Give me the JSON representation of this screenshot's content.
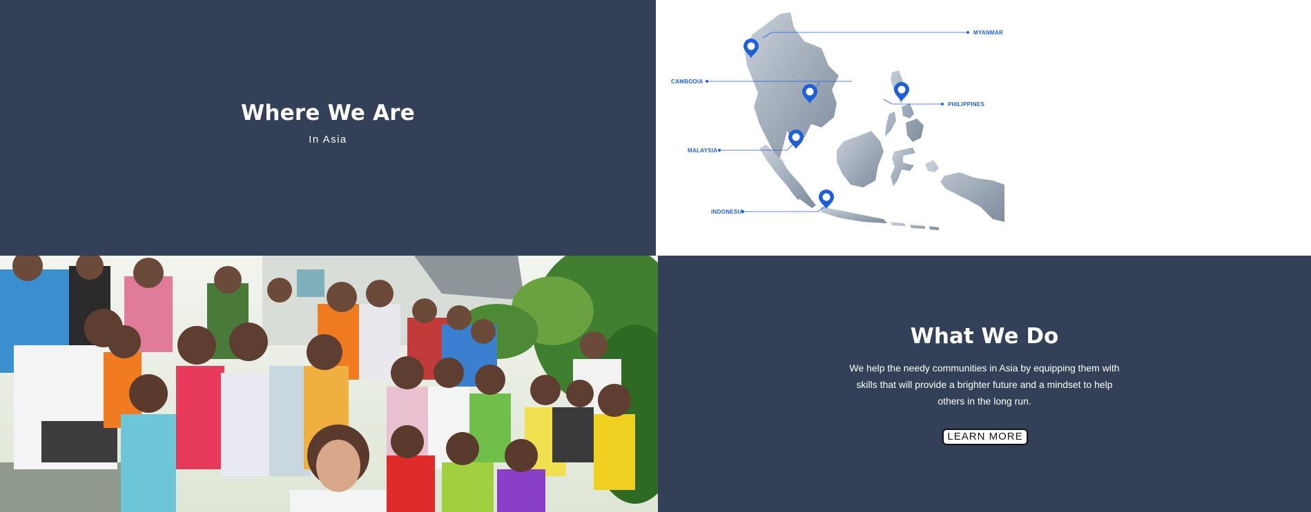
{
  "where_we_are": {
    "title": "Where We Are",
    "subtitle": "In Asia"
  },
  "map": {
    "locations": [
      "MYANMAR",
      "CAMBODIA",
      "PHILIPPINES",
      "MALAYSIA",
      "INDONESIA"
    ],
    "pin_color": "#1f5fd6",
    "land_color": "#8e9bab"
  },
  "what_we_do": {
    "title": "What We Do",
    "body": "We help the needy communities in Asia by equipping them with skills that will provide a brighter future and a mindset to help others in the long run.",
    "button_label": "LEARN MORE"
  },
  "colors": {
    "panel_bg": "#334058",
    "accent": "#1f5fd6"
  }
}
